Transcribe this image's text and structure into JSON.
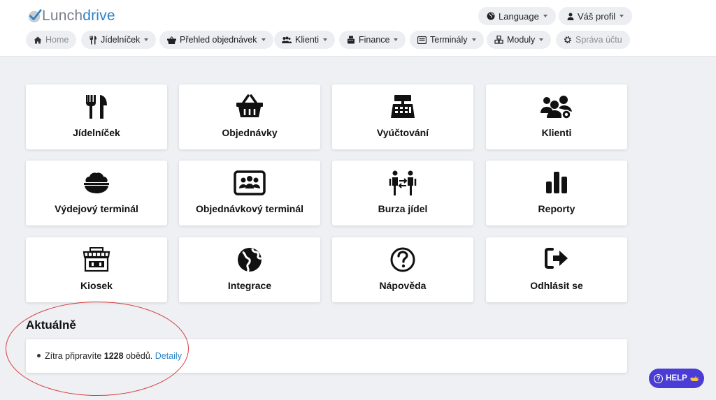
{
  "brand": {
    "part1": "Lunch",
    "part2": "drive"
  },
  "top": {
    "language": "Language",
    "profile": "Váš profil"
  },
  "nav": {
    "home": "Home",
    "menu": "Jídelníček",
    "orders": "Přehled objednávek",
    "clients": "Klienti",
    "finance": "Finance",
    "terminals": "Terminály",
    "modules": "Moduly",
    "account": "Správa účtu"
  },
  "tiles": [
    {
      "label": "Jídelníček",
      "icon": "utensils-icon"
    },
    {
      "label": "Objednávky",
      "icon": "basket-icon"
    },
    {
      "label": "Vyúčtování",
      "icon": "cash-register-icon"
    },
    {
      "label": "Klienti",
      "icon": "users-gear-icon"
    },
    {
      "label": "Výdejový terminál",
      "icon": "bowl-food-icon"
    },
    {
      "label": "Objednávkový terminál",
      "icon": "people-screen-icon"
    },
    {
      "label": "Burza jídel",
      "icon": "people-exchange-icon"
    },
    {
      "label": "Reporty",
      "icon": "bar-chart-icon"
    },
    {
      "label": "Kiosek",
      "icon": "shop-icon"
    },
    {
      "label": "Integrace",
      "icon": "globe-icon"
    },
    {
      "label": "Nápověda",
      "icon": "question-circle-icon"
    },
    {
      "label": "Odhlásit se",
      "icon": "sign-out-icon"
    }
  ],
  "news": {
    "title": "Aktuálně",
    "text_before": "Zítra připravíte ",
    "count": "1228",
    "text_after": " obědů. ",
    "link": "Detaily"
  },
  "help": {
    "label": "HELP"
  },
  "colors": {
    "brand": "#2d83c5",
    "help": "#4a3cd4",
    "annotation": "#d93a3a"
  }
}
